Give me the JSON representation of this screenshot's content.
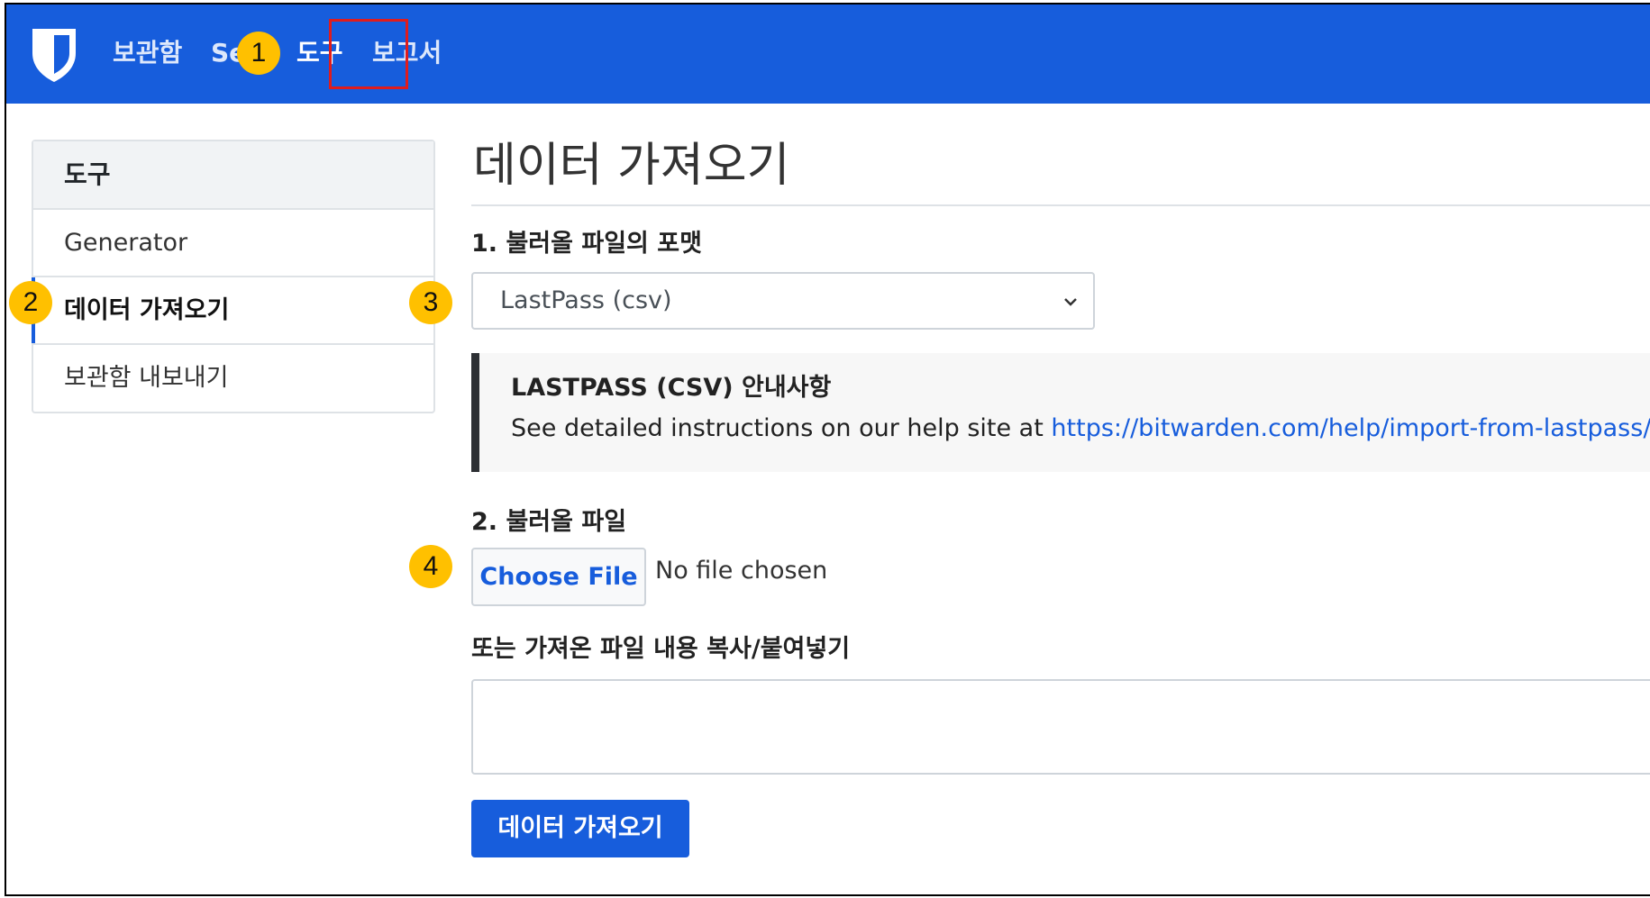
{
  "navbar": {
    "items": [
      {
        "label": "보관함"
      },
      {
        "label": "Se"
      },
      {
        "label": "도구",
        "active": true
      },
      {
        "label": "보고서"
      }
    ]
  },
  "sidebar": {
    "header": "도구",
    "items": [
      {
        "label": "Generator"
      },
      {
        "label": "데이터 가져오기",
        "active": true
      },
      {
        "label": "보관함 내보내기"
      }
    ]
  },
  "main": {
    "title": "데이터 가져오기",
    "format_label": "1. 불러올 파일의 포맷",
    "format_selected": "LastPass (csv)",
    "notice_title": "LASTPASS (CSV) 안내사항",
    "notice_text": "See detailed instructions on our help site at ",
    "notice_link": "https://bitwarden.com/help/import-from-lastpass/",
    "file_label": "2. 불러올 파일",
    "choose_file": "Choose File",
    "file_status": "No file chosen",
    "paste_label": "또는 가져온 파일 내용 복사/붙여넣기",
    "submit_label": "데이터 가져오기"
  },
  "markers": [
    "1",
    "2",
    "3",
    "4"
  ],
  "colors": {
    "brand": "#175ddc",
    "marker": "#ffc000",
    "highlight": "#e01c1c"
  }
}
